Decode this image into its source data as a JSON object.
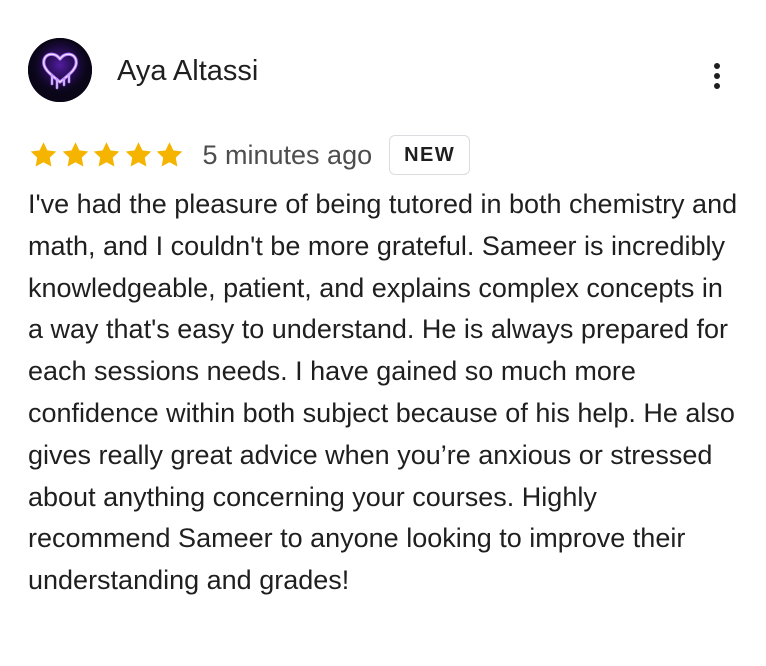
{
  "review": {
    "author": {
      "name": "Aya Altassi",
      "avatar_icon": "neon-dripping-heart-icon"
    },
    "menu_icon": "more-vert-icon",
    "rating": 5,
    "rating_max": 5,
    "star_color": "#f4b400",
    "timestamp": "5 minutes ago",
    "badge": "NEW",
    "text": "I've had the pleasure of being tutored in both chemistry and math, and I couldn't be more grateful. Sameer is incredibly knowledgeable, patient, and explains complex concepts in a way that's easy to understand. He is always prepared for each sessions needs. I have gained so much more confidence within both subject because of his help. He also gives really great advice when you’re anxious or stressed about anything concerning your courses. Highly recommend Sameer to anyone looking to improve their understanding and grades!"
  }
}
